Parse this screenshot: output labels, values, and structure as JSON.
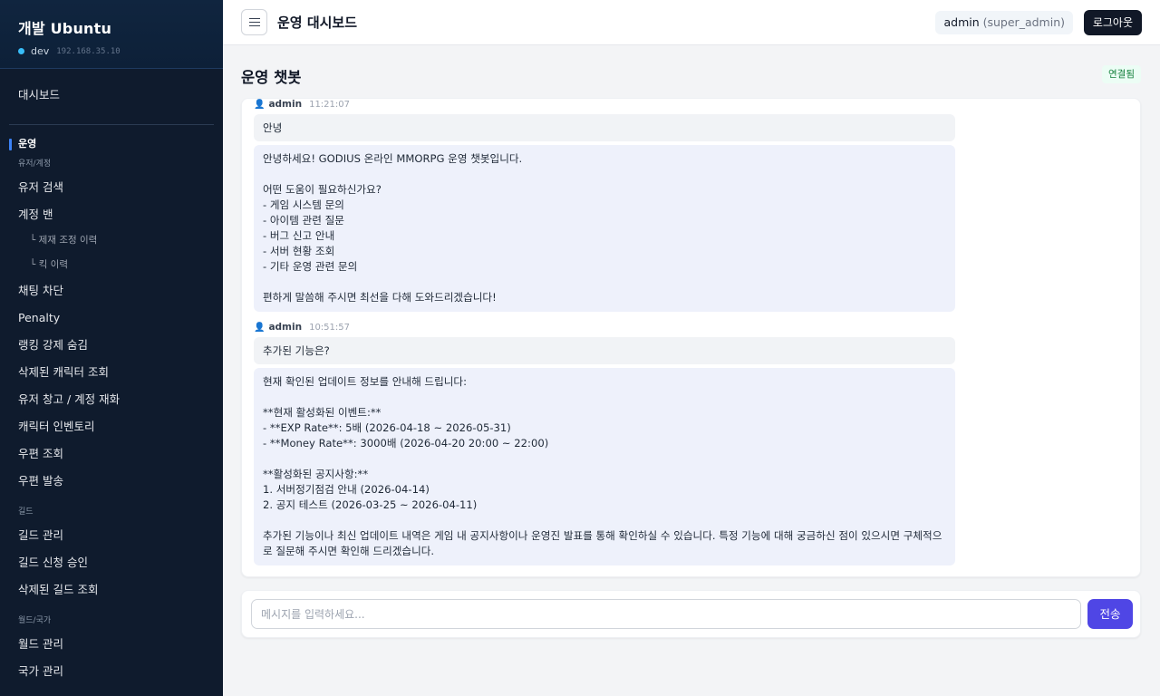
{
  "sidebar": {
    "title": "개발 Ubuntu",
    "env": "dev",
    "ip": "192.168.35.10",
    "dashboard": "대시보드",
    "active_section": "운영",
    "section_user": "유저/계정",
    "items_user": [
      "유저 검색",
      "계정 밴"
    ],
    "subitems_ban": [
      "└ 제재 조정 이력",
      "└ 킥 이력"
    ],
    "items_ops": [
      "채팅 차단",
      "Penalty",
      "랭킹 강제 숨김",
      "삭제된 캐릭터 조회",
      "유저 창고 / 계정 재화",
      "캐릭터 인벤토리",
      "우편 조회",
      "우편 발송"
    ],
    "section_guild": "길드",
    "items_guild": [
      "길드 관리",
      "길드 신청 승인",
      "삭제된 길드 조회"
    ],
    "section_world": "월드/국가",
    "items_world": [
      "월드 관리",
      "국가 관리"
    ]
  },
  "header": {
    "title": "운영 대시보드",
    "user": "admin",
    "role": "(super_admin)",
    "logout": "로그아웃"
  },
  "main": {
    "title": "운영 챗봇",
    "status": "연결됨"
  },
  "chat": {
    "messages": [
      {
        "user": "admin",
        "time": "11:21:07",
        "question": "안녕",
        "answer": "안녕하세요! GODIUS 온라인 MMORPG 운영 챗봇입니다.\n\n어떤 도움이 필요하신가요?\n- 게임 시스템 문의\n- 아이템 관련 질문\n- 버그 신고 안내\n- 서버 현황 조회\n- 기타 운영 관련 문의\n\n편하게 말씀해 주시면 최선을 다해 도와드리겠습니다!"
      },
      {
        "user": "admin",
        "time": "10:51:57",
        "question": "추가된 기능은?",
        "answer": "현재 확인된 업데이트 정보를 안내해 드립니다:\n\n**현재 활성화된 이벤트:**\n- **EXP Rate**: 5배 (2026-04-18 ~ 2026-05-31)\n- **Money Rate**: 3000배 (2026-04-20 20:00 ~ 22:00)\n\n**활성화된 공지사항:**\n1. 서버정기점검 안내 (2026-04-14)\n2. 공지 테스트 (2026-03-25 ~ 2026-04-11)\n\n추가된 기능이나 최신 업데이트 내역은 게임 내 공지사항이나 운영진 발표를 통해 확인하실 수 있습니다. 특정 기능에 대해 궁금하신 점이 있으시면 구체적으로 질문해 주시면 확인해 드리겠습니다."
      }
    ]
  },
  "composer": {
    "placeholder": "메시지를 입력하세요...",
    "value": "",
    "send": "전송"
  },
  "icons": {
    "user": "👤"
  },
  "colors": {
    "sidebar_bg": "#0f1b2d",
    "accent": "#4f46e5",
    "active_marker": "#3b82f6",
    "status_green": "#15803d"
  }
}
